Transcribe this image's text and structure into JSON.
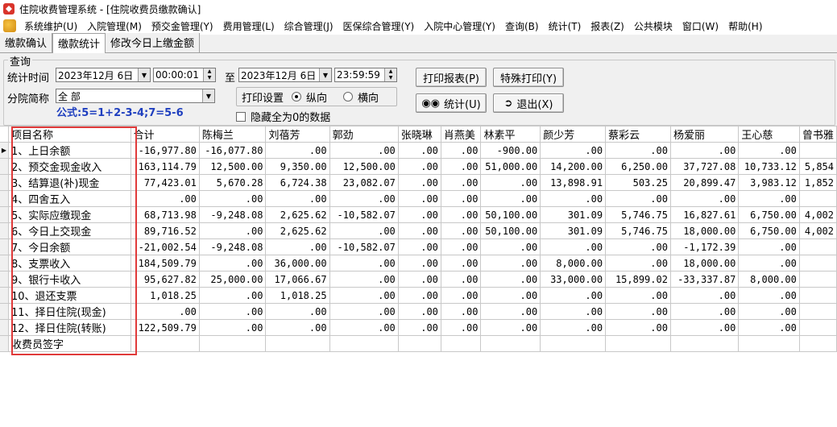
{
  "window": {
    "title": "住院收费管理系统 - [住院收费员缴款确认]"
  },
  "menu": [
    "系统维护(U)",
    "入院管理(M)",
    "预交金管理(Y)",
    "费用管理(L)",
    "综合管理(J)",
    "医保综合管理(Y)",
    "入院中心管理(Y)",
    "查询(B)",
    "统计(T)",
    "报表(Z)",
    "公共模块",
    "窗口(W)",
    "帮助(H)"
  ],
  "tabs": [
    "缴款确认",
    "缴款统计",
    "修改今日上缴金额"
  ],
  "query": {
    "group_title": "查询",
    "time_label": "统计时间",
    "start_date": "2023年12月 6日",
    "start_time": "00:00:01",
    "to_label": "至",
    "end_date": "2023年12月 6日",
    "end_time": "23:59:59",
    "branch_label": "分院简称",
    "branch_value": "全 部",
    "formula": "公式:5=1+2-3-4;7=5-6",
    "print_setting_label": "打印设置",
    "orient_portrait": "纵向",
    "orient_landscape": "横向",
    "hide_zero_label": "隐藏全为0的数据"
  },
  "buttons": {
    "print_report": "打印报表(P)",
    "special_print": "特殊打印(Y)",
    "statistics": "统计(U)",
    "exit": "退出(X)"
  },
  "table": {
    "headers": [
      "项目名称",
      "合计",
      "陈梅兰",
      "刘蓓芳",
      "郭劲",
      "张晓琳",
      "肖燕美",
      "林素平",
      "颜少芳",
      "蔡彩云",
      "杨爱丽",
      "王心慈",
      "曾书雅"
    ],
    "rows": [
      [
        "1、上日余额",
        "-16,977.80",
        "-16,077.80",
        ".00",
        ".00",
        ".00",
        ".00",
        "-900.00",
        ".00",
        ".00",
        ".00",
        ".00",
        ""
      ],
      [
        "2、预交金现金收入",
        "163,114.79",
        "12,500.00",
        "9,350.00",
        "12,500.00",
        ".00",
        ".00",
        "51,000.00",
        "14,200.00",
        "6,250.00",
        "37,727.08",
        "10,733.12",
        "5,854"
      ],
      [
        "3、结算退(补)现金",
        "77,423.01",
        "5,670.28",
        "6,724.38",
        "23,082.07",
        ".00",
        ".00",
        ".00",
        "13,898.91",
        "503.25",
        "20,899.47",
        "3,983.12",
        "1,852"
      ],
      [
        "4、四舍五入",
        ".00",
        ".00",
        ".00",
        ".00",
        ".00",
        ".00",
        ".00",
        ".00",
        ".00",
        ".00",
        ".00",
        ""
      ],
      [
        "5、实际应缴现金",
        "68,713.98",
        "-9,248.08",
        "2,625.62",
        "-10,582.07",
        ".00",
        ".00",
        "50,100.00",
        "301.09",
        "5,746.75",
        "16,827.61",
        "6,750.00",
        "4,002"
      ],
      [
        "6、今日上交现金",
        "89,716.52",
        ".00",
        "2,625.62",
        ".00",
        ".00",
        ".00",
        "50,100.00",
        "301.09",
        "5,746.75",
        "18,000.00",
        "6,750.00",
        "4,002"
      ],
      [
        "7、今日余额",
        "-21,002.54",
        "-9,248.08",
        ".00",
        "-10,582.07",
        ".00",
        ".00",
        ".00",
        ".00",
        ".00",
        "-1,172.39",
        ".00",
        ""
      ],
      [
        "8、支票收入",
        "184,509.79",
        ".00",
        "36,000.00",
        ".00",
        ".00",
        ".00",
        ".00",
        "8,000.00",
        ".00",
        "18,000.00",
        ".00",
        ""
      ],
      [
        "9、银行卡收入",
        "95,627.82",
        "25,000.00",
        "17,066.67",
        ".00",
        ".00",
        ".00",
        ".00",
        "33,000.00",
        "15,899.02",
        "-33,337.87",
        "8,000.00",
        ""
      ],
      [
        "10、退还支票",
        "1,018.25",
        ".00",
        "1,018.25",
        ".00",
        ".00",
        ".00",
        ".00",
        ".00",
        ".00",
        ".00",
        ".00",
        ""
      ],
      [
        "11、择日住院(现金)",
        ".00",
        ".00",
        ".00",
        ".00",
        ".00",
        ".00",
        ".00",
        ".00",
        ".00",
        ".00",
        ".00",
        ""
      ],
      [
        "12、择日住院(转账)",
        "122,509.79",
        ".00",
        ".00",
        ".00",
        ".00",
        ".00",
        ".00",
        ".00",
        ".00",
        ".00",
        ".00",
        ""
      ],
      [
        "收费员签字",
        "",
        "",
        "",
        "",
        "",
        "",
        "",
        "",
        "",
        "",
        "",
        ""
      ]
    ]
  },
  "colors": {
    "highlight_border": "#e03a3a",
    "formula_text": "#1f3fbf"
  }
}
